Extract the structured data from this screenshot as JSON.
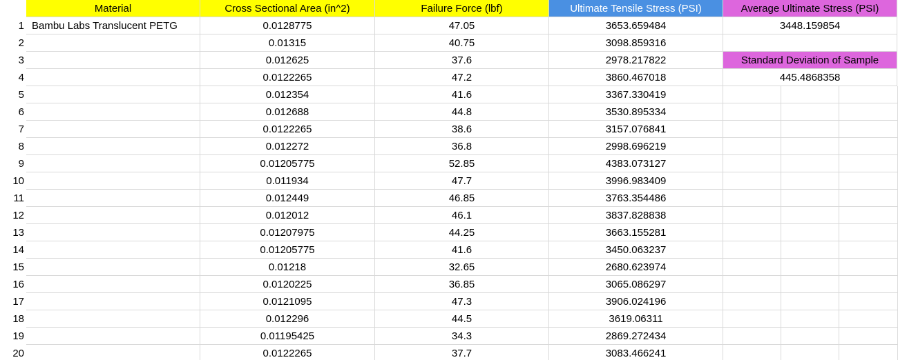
{
  "headers": {
    "material": "Material",
    "area": "Cross Sectional Area (in^2)",
    "force": "Failure Force (lbf)",
    "uts": "Ultimate Tensile Stress (PSI)",
    "avg": "Average Ultimate Stress (PSI)"
  },
  "summary": {
    "average_value": "3448.159854",
    "std_label": "Standard Deviation of Sample",
    "std_value": "445.4868358"
  },
  "colors": {
    "header_yellow": "#ffff00",
    "header_blue": "#4a90e2",
    "header_pink": "#dd66dd",
    "gridline": "#d9d9d9"
  },
  "rows": [
    {
      "n": "1",
      "material": "Bambu Labs Translucent PETG",
      "area": "0.0128775",
      "force": "47.05",
      "uts": "3653.659484"
    },
    {
      "n": "2",
      "material": "",
      "area": "0.01315",
      "force": "40.75",
      "uts": "3098.859316"
    },
    {
      "n": "3",
      "material": "",
      "area": "0.012625",
      "force": "37.6",
      "uts": "2978.217822"
    },
    {
      "n": "4",
      "material": "",
      "area": "0.0122265",
      "force": "47.2",
      "uts": "3860.467018"
    },
    {
      "n": "5",
      "material": "",
      "area": "0.012354",
      "force": "41.6",
      "uts": "3367.330419"
    },
    {
      "n": "6",
      "material": "",
      "area": "0.012688",
      "force": "44.8",
      "uts": "3530.895334"
    },
    {
      "n": "7",
      "material": "",
      "area": "0.0122265",
      "force": "38.6",
      "uts": "3157.076841"
    },
    {
      "n": "8",
      "material": "",
      "area": "0.012272",
      "force": "36.8",
      "uts": "2998.696219"
    },
    {
      "n": "9",
      "material": "",
      "area": "0.01205775",
      "force": "52.85",
      "uts": "4383.073127"
    },
    {
      "n": "10",
      "material": "",
      "area": "0.011934",
      "force": "47.7",
      "uts": "3996.983409"
    },
    {
      "n": "11",
      "material": "",
      "area": "0.012449",
      "force": "46.85",
      "uts": "3763.354486"
    },
    {
      "n": "12",
      "material": "",
      "area": "0.012012",
      "force": "46.1",
      "uts": "3837.828838"
    },
    {
      "n": "13",
      "material": "",
      "area": "0.01207975",
      "force": "44.25",
      "uts": "3663.155281"
    },
    {
      "n": "14",
      "material": "",
      "area": "0.01205775",
      "force": "41.6",
      "uts": "3450.063237"
    },
    {
      "n": "15",
      "material": "",
      "area": "0.01218",
      "force": "32.65",
      "uts": "2680.623974"
    },
    {
      "n": "16",
      "material": "",
      "area": "0.0120225",
      "force": "36.85",
      "uts": "3065.086297"
    },
    {
      "n": "17",
      "material": "",
      "area": "0.0121095",
      "force": "47.3",
      "uts": "3906.024196"
    },
    {
      "n": "18",
      "material": "",
      "area": "0.012296",
      "force": "44.5",
      "uts": "3619.06311"
    },
    {
      "n": "19",
      "material": "",
      "area": "0.01195425",
      "force": "34.3",
      "uts": "2869.272434"
    },
    {
      "n": "20",
      "material": "",
      "area": "0.0122265",
      "force": "37.7",
      "uts": "3083.466241"
    }
  ]
}
